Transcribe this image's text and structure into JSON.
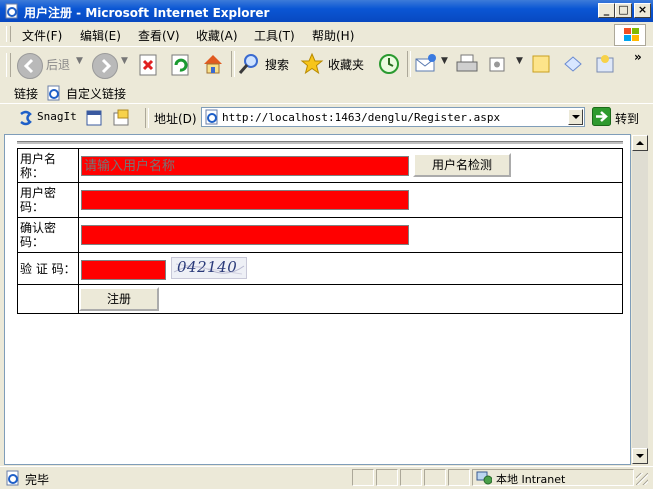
{
  "window": {
    "title": "用户注册 - Microsoft Internet Explorer"
  },
  "menu": [
    "文件(F)",
    "编辑(E)",
    "查看(V)",
    "收藏(A)",
    "工具(T)",
    "帮助(H)"
  ],
  "toolbar": {
    "back_label": "后退",
    "search_label": "搜索",
    "favorites_label": "收藏夹"
  },
  "links": {
    "label": "链接",
    "custom_link": "自定义链接"
  },
  "snagit": {
    "label": "SnagIt"
  },
  "address": {
    "label": "地址(D)",
    "url": "http://localhost:1463/denglu/Register.aspx",
    "go_label": "转到"
  },
  "form": {
    "username_label_1": "用户名",
    "username_label_2": "称：",
    "username_placeholder": "请输入用户名称",
    "check_button": "用户名检测",
    "password_label_1": "用户密",
    "password_label_2": "码：",
    "confirm_label_1": "确认密",
    "confirm_label_2": "码：",
    "captcha_label": "验 证 码：",
    "captcha_text": "042140",
    "submit_button": "注册"
  },
  "status": {
    "text": "完毕",
    "zone": "本地 Intranet"
  },
  "colors": {
    "input_bg": "#ff0000",
    "title_bar": "#0a56d4"
  }
}
